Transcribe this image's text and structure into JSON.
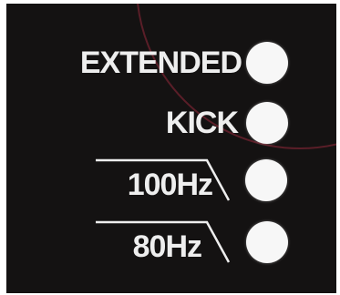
{
  "buttons": [
    {
      "label": "EXTENDED"
    },
    {
      "label": "KICK"
    },
    {
      "label": "100Hz"
    },
    {
      "label": "80Hz"
    }
  ],
  "colors": {
    "panel": "#141212",
    "text": "#eeeeee",
    "led": "#f7f7f7",
    "arc": "#5a1e28"
  },
  "icons": [
    "high-pass-filter-icon"
  ]
}
